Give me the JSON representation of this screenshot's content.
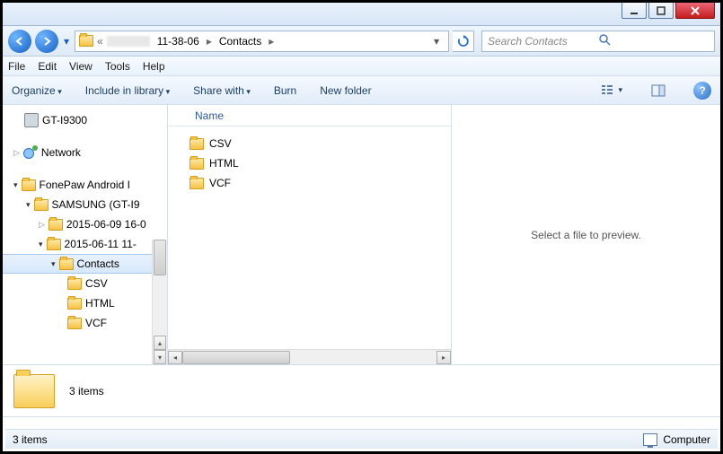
{
  "window": {
    "minimize": "–",
    "maximize": "◻",
    "close": "✕"
  },
  "breadcrumbs": {
    "prefix": "«",
    "seg1": "11-38-06",
    "seg2": "Contacts"
  },
  "search": {
    "placeholder": "Search Contacts"
  },
  "menu": {
    "file": "File",
    "edit": "Edit",
    "view": "View",
    "tools": "Tools",
    "help": "Help"
  },
  "toolbar": {
    "organize": "Organize",
    "include": "Include in library",
    "share": "Share with",
    "burn": "Burn",
    "newfolder": "New folder"
  },
  "tree": {
    "i0": "GT-I9300",
    "i1": "Network",
    "i2": "FonePaw Android I",
    "i3": "SAMSUNG (GT-I9",
    "i4": "2015-06-09 16-0",
    "i5": "2015-06-11 11-",
    "i6": "Contacts",
    "i7": "CSV",
    "i8": "HTML",
    "i9": "VCF"
  },
  "filelist": {
    "header": "Name",
    "f0": "CSV",
    "f1": "HTML",
    "f2": "VCF"
  },
  "preview": {
    "msg": "Select a file to preview."
  },
  "details": {
    "count": "3 items"
  },
  "status": {
    "left": "3 items",
    "right": "Computer"
  }
}
